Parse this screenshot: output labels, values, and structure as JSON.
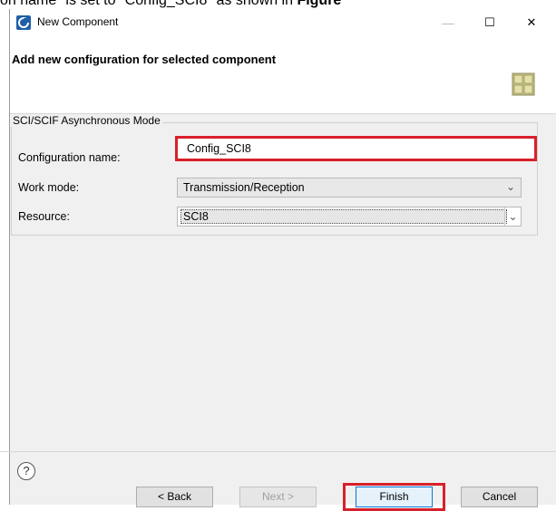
{
  "document": {
    "text_prefix": "on name\" is set to \"Config_SCI8\" as shown in ",
    "text_bold": "Figure"
  },
  "window": {
    "title": "New Component",
    "controls": {
      "minimize": "—",
      "maximize": "☐",
      "close": "✕"
    }
  },
  "header": {
    "title": "Add new configuration for selected component"
  },
  "group": {
    "legend": "SCI/SCIF Asynchronous Mode"
  },
  "form": {
    "config_name_label": "Configuration name:",
    "config_name_value": "Config_SCI8",
    "work_mode_label": "Work mode:",
    "work_mode_value": "Transmission/Reception",
    "resource_label": "Resource:",
    "resource_value": "SCI8"
  },
  "footer": {
    "help": "?",
    "back": "< Back",
    "next": "Next >",
    "finish": "Finish",
    "cancel": "Cancel"
  },
  "colors": {
    "highlight": "#d8202a",
    "accent": "#0078d7"
  }
}
